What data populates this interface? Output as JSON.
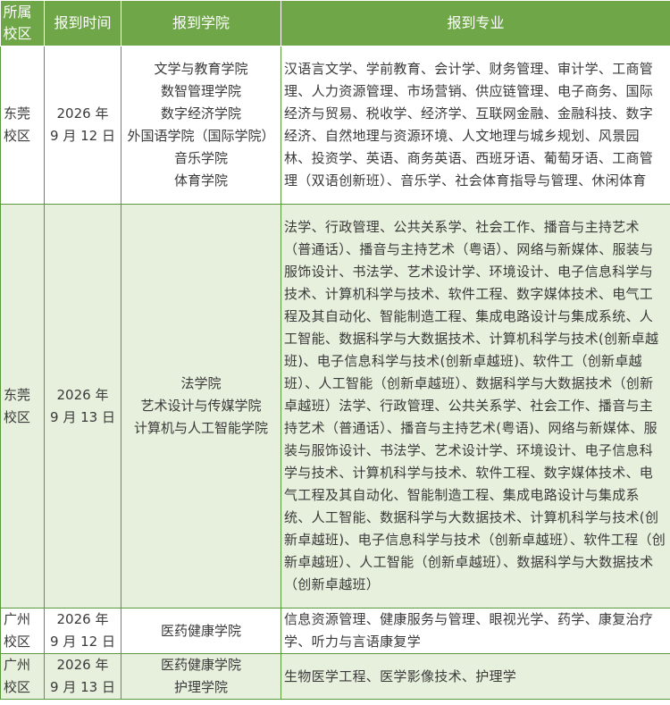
{
  "headers": {
    "campus": [
      "所属",
      "校区"
    ],
    "date": "报到时间",
    "college": "报到学院",
    "majors": "报到专业"
  },
  "rows": [
    {
      "campus": [
        "东莞",
        "校区"
      ],
      "date": [
        "2026 年",
        "9 月 12 日"
      ],
      "colleges": [
        "文学与教育学院",
        "数智管理学院",
        "数字经济学院",
        "外国语学院（国际学院）",
        "音乐学院",
        "体育学院"
      ],
      "majors": "汉语言文学、学前教育、会计学、财务管理、审计学、工商管理、人力资源管理、市场营销、供应链管理、电子商务、国际经济与贸易、税收学、经济学、互联网金融、金融科技、数字经济、自然地理与资源环境、人文地理与城乡规划、风景园林、投资学、英语、商务英语、西班牙语、葡萄牙语、工商管理（双语创新班）、音乐学、社会体育指导与管理、休闲体育"
    },
    {
      "campus": [
        "东莞",
        "校区"
      ],
      "date": [
        "2026 年",
        "9 月 13 日"
      ],
      "colleges": [
        "法学院",
        "艺术设计与传媒学院",
        "计算机与人工智能学院"
      ],
      "majors": "法学、行政管理、公共关系学、社会工作、播音与主持艺术（普通话）、播音与主持艺术（粤语）、网络与新媒体、服装与服饰设计、书法学、艺术设计学、环境设计、电子信息科学与技术、计算机科学与技术、软件工程、数字媒体技术、电气工程及其自动化、智能制造工程、集成电路设计与集成系统、人工智能、数据科学与大数据技术、计算机科学与技术(创新卓越班)、电子信息科学与技术(创新卓越班)、软件工（创新卓越班）、人工智能（创新卓越班）、数据科学与大数据技术（创新卓越班）法学、行政管理、公共关系学、社会工作、播音与主持艺术（普通话）、播音与主持艺术(粤语)、网络与新媒体、服装与服饰设计、书法学、艺术设计学、环境设计、电子信息科学与技术、计算机科学与技术、软件工程、数字媒体技术、电气工程及其自动化、智能制造工程、集成电路设计与集成系统、人工智能、数据科学与大数据技术、计算机科学与技术(创新卓越班)、电子信息科学与技术（创新卓越班）、软件工程（创新卓越班）、人工智能（创新卓越班）、数据科学与大数据技术（创新卓越班）"
    },
    {
      "campus": [
        "广州",
        "校区"
      ],
      "date": [
        "2026 年",
        "9 月 12 日"
      ],
      "colleges": [
        "医药健康学院"
      ],
      "majors": "信息资源管理、健康服务与管理、眼视光学、药学、康复治疗学、听力与言语康复学"
    },
    {
      "campus": [
        "广州",
        "校区"
      ],
      "date": [
        "2026 年",
        "9 月 13 日"
      ],
      "colleges": [
        "医药健康学院",
        "护理学院"
      ],
      "majors": "生物医学工程、医学影像技术、护理学"
    }
  ]
}
